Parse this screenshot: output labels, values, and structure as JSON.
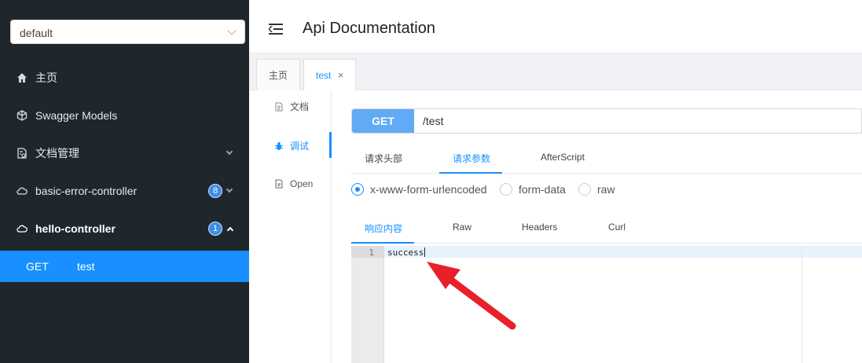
{
  "sidebar": {
    "group_select": {
      "value": "default"
    },
    "items": [
      {
        "label": "主页",
        "icon": "home-icon"
      },
      {
        "label": "Swagger Models",
        "icon": "cube-icon"
      },
      {
        "label": "文档管理",
        "icon": "document-settings-icon"
      },
      {
        "label": "basic-error-controller",
        "icon": "cloud-icon",
        "badge": "8"
      },
      {
        "label": "hello-controller",
        "icon": "cloud-icon",
        "badge": "1"
      }
    ],
    "sub_item": {
      "method": "GET",
      "path": "test"
    }
  },
  "header": {
    "title": "Api Documentation",
    "menu_icon": "menu-fold-icon"
  },
  "tabs": [
    {
      "label": "主页"
    },
    {
      "label": "test",
      "close": "×"
    }
  ],
  "side_tabs": [
    {
      "label": "文档",
      "icon": "file-icon"
    },
    {
      "label": "调试",
      "icon": "bug-icon"
    },
    {
      "label": "Open",
      "icon": "file-text-icon"
    }
  ],
  "request": {
    "method": "GET",
    "path": "/test"
  },
  "param_tabs": [
    "请求头部",
    "请求参数",
    "AfterScript"
  ],
  "body_types": [
    "x-www-form-urlencoded",
    "form-data",
    "raw"
  ],
  "response_tabs": [
    "响应内容",
    "Raw",
    "Headers",
    "Curl"
  ],
  "response": {
    "line_number": "1",
    "content": "success"
  },
  "colors": {
    "accent": "#1890ff",
    "sidebar_bg": "#1f272d",
    "method_bg": "#60aaf6",
    "arrow": "#e8202a"
  }
}
